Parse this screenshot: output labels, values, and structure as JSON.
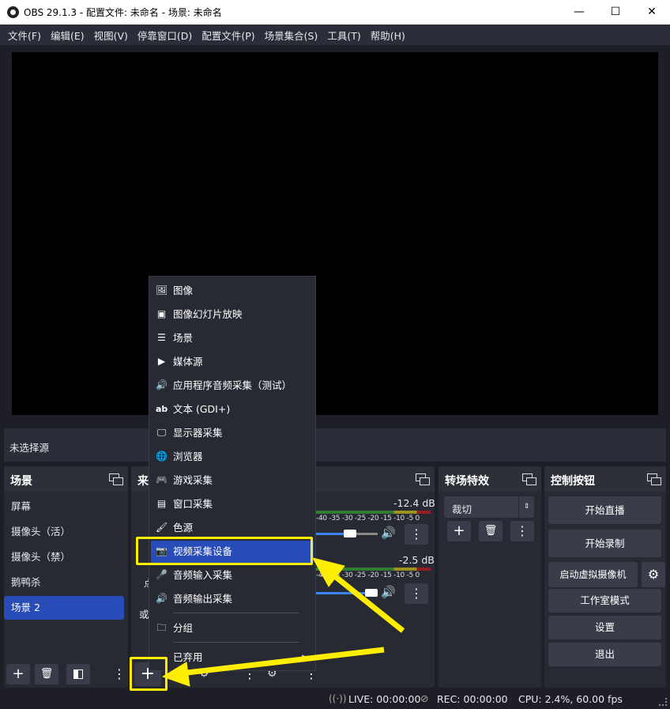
{
  "window": {
    "title": "OBS 29.1.3 - 配置文件: 未命名 - 场景: 未命名",
    "min_glyph": "—",
    "max_glyph": "☐",
    "close_glyph": "✕"
  },
  "menubar": [
    "文件(F)",
    "编辑(E)",
    "视图(V)",
    "停靠窗口(D)",
    "配置文件(P)",
    "场景集合(S)",
    "工具(T)",
    "帮助(H)"
  ],
  "source_bar": {
    "label": "未选择源"
  },
  "scenes": {
    "title": "场景",
    "items": [
      "屏幕",
      "摄像头（活）",
      "摄像头（禁）",
      "鹅鸭杀",
      "场景 2"
    ],
    "active_index": 4,
    "add": "+",
    "remove": "🗑"
  },
  "sources": {
    "title_partial": "来",
    "partial_texts": [
      "点",
      "或"
    ],
    "add": "+"
  },
  "mixer": {
    "tracks": [
      {
        "db": "-12.4 dB",
        "level": 0.55
      },
      {
        "db": "-2.5 dB",
        "level": 0.9
      }
    ],
    "ticks": "-40 -35 -30 -25 -20 -15 -10 -5 0"
  },
  "transitions": {
    "title": "转场特效",
    "selected": "裁切",
    "add": "+",
    "remove": "🗑"
  },
  "controls": {
    "title": "控制按钮",
    "buttons": [
      "开始直播",
      "开始录制",
      "启动虚拟摄像机",
      "工作室模式",
      "设置",
      "退出"
    ],
    "gear": "⚙"
  },
  "popup_menu": {
    "items": [
      {
        "label": "图像",
        "icon": "image-icon",
        "glyph": "🖼"
      },
      {
        "label": "图像幻灯片放映",
        "icon": "slideshow-icon",
        "glyph": "▣"
      },
      {
        "label": "场景",
        "icon": "list-icon",
        "glyph": "☰"
      },
      {
        "label": "媒体源",
        "icon": "play-icon",
        "glyph": "▶"
      },
      {
        "label": "应用程序音频采集（测试）",
        "icon": "app-audio-icon",
        "glyph": "🔊"
      },
      {
        "label": "文本 (GDI+)",
        "icon": "text-icon",
        "glyph": "ab"
      },
      {
        "label": "显示器采集",
        "icon": "monitor-icon",
        "glyph": "🖵"
      },
      {
        "label": "浏览器",
        "icon": "globe-icon",
        "glyph": "🌐"
      },
      {
        "label": "游戏采集",
        "icon": "gamepad-icon",
        "glyph": "🎮"
      },
      {
        "label": "窗口采集",
        "icon": "window-icon",
        "glyph": "▤"
      },
      {
        "label": "色源",
        "icon": "brush-icon",
        "glyph": "🖌"
      },
      {
        "label": "视频采集设备",
        "icon": "camera-icon",
        "glyph": "📷"
      },
      {
        "label": "音频输入采集",
        "icon": "microphone-icon",
        "glyph": "🎤"
      },
      {
        "label": "音频输出采集",
        "icon": "speaker-icon",
        "glyph": "🔊"
      }
    ],
    "group": {
      "label": "分组",
      "icon": "folder-icon",
      "glyph": "🗀"
    },
    "deprecated": {
      "label": "已弃用",
      "arrow": "▶"
    },
    "selected_index": 11
  },
  "status": {
    "live": "LIVE: 00:00:00",
    "rec": "REC: 00:00:00",
    "cpu": "CPU: 2.4%, 60.00 fps"
  },
  "colors": {
    "accent": "#284cb8",
    "annotation": "#ffee00",
    "background": "#1e1f26",
    "panel": "#272a33"
  }
}
